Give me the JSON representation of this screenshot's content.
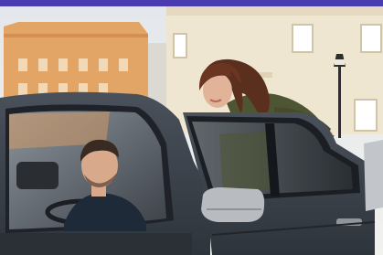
{
  "photo": {
    "subject": "woman-entering-rideshare-car",
    "accent_bar_color": "#4a3bb0",
    "palette": {
      "sky": "#e9ecef",
      "building_orange": "#e3a565",
      "building_cream": "#efe6d2",
      "car_body": "#3e454f",
      "car_dark": "#25292f",
      "jacket": "#4e5532",
      "hair": "#5b2f1e",
      "skin": "#e1b49a"
    }
  }
}
